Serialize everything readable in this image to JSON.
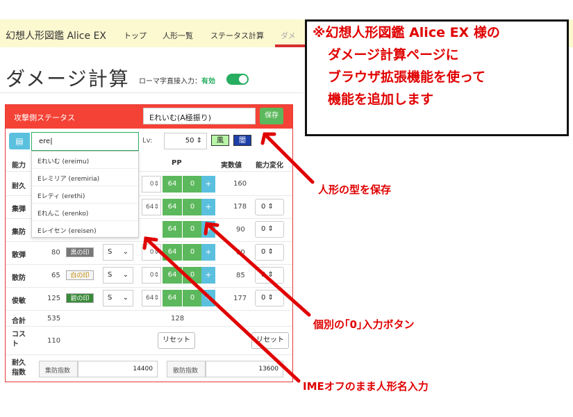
{
  "nav": {
    "brand": "幻想人形図鑑 Alice EX",
    "links": [
      "トップ",
      "人形一覧",
      "ステータス計算",
      "ダメ"
    ]
  },
  "header": {
    "title": "ダメージ計算",
    "romaji_label": "ローマ字直接入力：",
    "romaji_state": "有効"
  },
  "panel": {
    "title": "攻撃側ステータス",
    "build_name": "Eれいむ(A極振り)",
    "save_label": "保存",
    "search_value": "ere",
    "lv_label": "Lv:",
    "lv_value": "50",
    "badges": [
      "風",
      "闇"
    ],
    "col_headers": [
      "能力",
      "PP",
      "実数値",
      "能力変化"
    ],
    "rows": [
      {
        "label": "耐久",
        "spin": "0",
        "pp": "64",
        "zero": "0",
        "real": "160",
        "change": ""
      },
      {
        "label": "集弾",
        "spin": "64",
        "pp": "64",
        "zero": "0",
        "real": "178",
        "change": "0"
      },
      {
        "label": "集防",
        "spin": "",
        "pp": "64",
        "zero": "0",
        "real": "90",
        "change": "0"
      },
      {
        "label": "散弾",
        "base": "80",
        "seal": "黒の印",
        "rank": "S",
        "spin": "0",
        "pp": "64",
        "zero": "0",
        "real": "00",
        "change": "0"
      },
      {
        "label": "散防",
        "base": "65",
        "seal": "白の印",
        "rank": "S",
        "spin": "0",
        "pp": "64",
        "zero": "0",
        "real": "85",
        "change": "0"
      },
      {
        "label": "俊敏",
        "base": "125",
        "seal": "碧の印",
        "rank": "S",
        "spin": "64",
        "pp": "64",
        "zero": "0",
        "real": "177",
        "change": "0"
      }
    ],
    "total_label": "合計",
    "total_base": "535",
    "total_pp": "128",
    "cost_label": "コスト",
    "cost_value": "110",
    "reset_label": "リセット",
    "reset_label2": "リセット",
    "idx_row_label": "耐久指数",
    "idx1_label": "集防指数",
    "idx1_value": "14400",
    "idx2_label": "散防指数",
    "idx2_value": "13600",
    "suggestions": [
      "Eれいむ (ereimu)",
      "Eレミリア (eremiria)",
      "Eレティ (erethi)",
      "Eれんこ (erenko)",
      "Eレイセン (ereisen)"
    ]
  },
  "annotations": {
    "callout": [
      "※幻想人形図鑑 Alice EX 様の",
      "ダメージ計算ページに",
      "ブラウザ拡張機能を使って",
      "機能を追加します"
    ],
    "save_note": "人形の型を保存",
    "zero_note": "個別の｢0｣入力ボタン",
    "ime_note": "IMEオフのまま人形名入力"
  },
  "colors": {
    "accent_red": "#f44336",
    "green": "#5cb85c",
    "info": "#5bc0de",
    "annotation": "#e00000"
  }
}
